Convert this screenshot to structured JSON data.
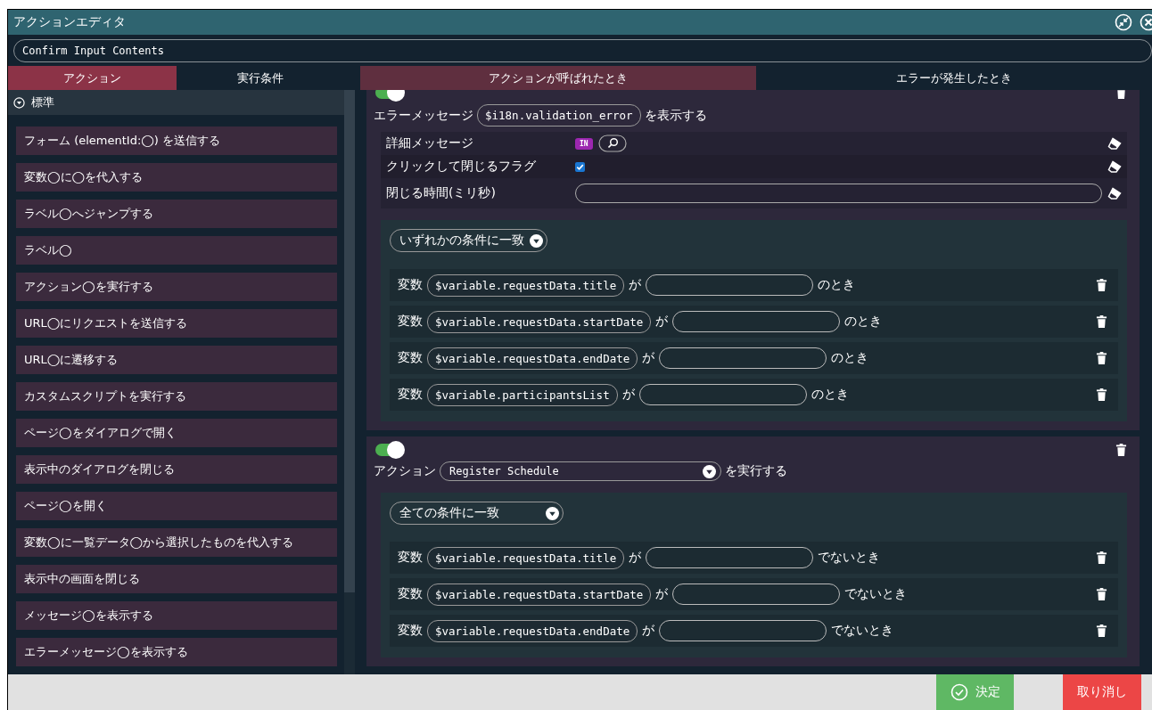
{
  "window": {
    "title": "アクションエディタ"
  },
  "name_field": {
    "value": "Confirm Input Contents"
  },
  "left_tabs": [
    {
      "label": "アクション",
      "selected": true
    },
    {
      "label": "実行条件",
      "selected": false
    }
  ],
  "right_tabs": [
    {
      "label": "アクションが呼ばれたとき",
      "selected": true
    },
    {
      "label": "エラーが発生したとき",
      "selected": false
    }
  ],
  "category": {
    "label": "標準",
    "expanded": true
  },
  "action_items": [
    "フォーム (elementId:◯) を送信する",
    "変数◯に◯を代入する",
    "ラベル◯へジャンプする",
    "ラベル◯",
    "アクション◯を実行する",
    "URL◯にリクエストを送信する",
    "URL◯に遷移する",
    "カスタムスクリプトを実行する",
    "ページ◯をダイアログで開く",
    "表示中のダイアログを閉じる",
    "ページ◯を開く",
    "変数◯に一覧データ◯から選択したものを代入する",
    "表示中の画面を閉じる",
    "メッセージ◯を表示する",
    "エラーメッセージ◯を表示する"
  ],
  "actions": [
    {
      "kind": "field",
      "enabled": true,
      "prefix": "エラーメッセージ",
      "value": "$i18n.validation_error",
      "suffix": "を表示する",
      "params": [
        {
          "kind": "expression",
          "label": "詳細メッセージ",
          "badge": "IN"
        },
        {
          "kind": "checkbox",
          "label": "クリックして閉じるフラグ",
          "checked": true
        },
        {
          "kind": "text",
          "label": "閉じる時間(ミリ秒)"
        }
      ],
      "match": "いずれかの条件に一致",
      "conditions": [
        {
          "label": "変数",
          "variable": "$variable.requestData.title",
          "particle": "が",
          "suffix": "のとき"
        },
        {
          "label": "変数",
          "variable": "$variable.requestData.startDate",
          "particle": "が",
          "suffix": "のとき"
        },
        {
          "label": "変数",
          "variable": "$variable.requestData.endDate",
          "particle": "が",
          "suffix": "のとき"
        },
        {
          "label": "変数",
          "variable": "$variable.participantsList",
          "particle": "が",
          "suffix": "のとき"
        }
      ]
    },
    {
      "kind": "select",
      "enabled": true,
      "prefix": "アクション",
      "value": "Register Schedule",
      "suffix": "を実行する",
      "match": "全ての条件に一致",
      "conditions": [
        {
          "label": "変数",
          "variable": "$variable.requestData.title",
          "particle": "が",
          "suffix": "でないとき"
        },
        {
          "label": "変数",
          "variable": "$variable.requestData.startDate",
          "particle": "が",
          "suffix": "でないとき"
        },
        {
          "label": "変数",
          "variable": "$variable.requestData.endDate",
          "particle": "が",
          "suffix": "でないとき"
        }
      ]
    }
  ],
  "buttons": [
    {
      "kind": "ok",
      "label": "決定"
    },
    {
      "kind": "cancel",
      "label": "取り消し"
    }
  ]
}
